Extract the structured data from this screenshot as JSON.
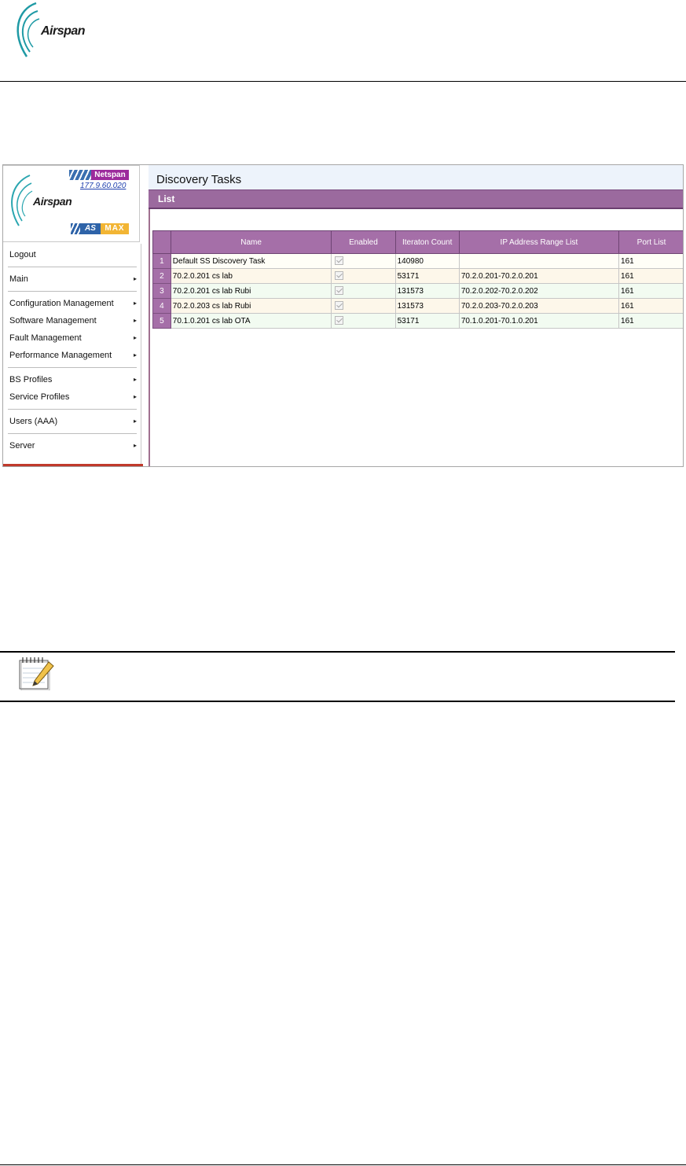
{
  "document": {
    "brand": "Airspan"
  },
  "app": {
    "sidebar": {
      "brand": "Airspan",
      "netspan_label": "Netspan",
      "version": "177.9.60.020",
      "asmax_as": "AS",
      "asmax_max": "MAX",
      "menu": [
        {
          "label": "Logout",
          "arrow": ""
        },
        {
          "label": "Main",
          "arrow": "▸"
        },
        {
          "label": "Configuration Management",
          "arrow": "▸"
        },
        {
          "label": "Software Management",
          "arrow": "▸"
        },
        {
          "label": "Fault Management",
          "arrow": "▸"
        },
        {
          "label": "Performance Management",
          "arrow": "▸"
        },
        {
          "label": "BS Profiles",
          "arrow": "▸"
        },
        {
          "label": "Service Profiles",
          "arrow": "▸"
        },
        {
          "label": "Users (AAA)",
          "arrow": "▸"
        },
        {
          "label": "Server",
          "arrow": "▸"
        }
      ]
    },
    "content": {
      "title": "Discovery Tasks",
      "section": "List",
      "columns": [
        "Name",
        "Enabled",
        "Iteraton Count",
        "IP Address Range List",
        "Port List"
      ],
      "rows": [
        {
          "num": "1",
          "name": "Default SS Discovery Task",
          "enabled": true,
          "count": "140980",
          "range": "",
          "port": "161"
        },
        {
          "num": "2",
          "name": "70.2.0.201 cs lab",
          "enabled": true,
          "count": "53171",
          "range": "70.2.0.201-70.2.0.201",
          "port": "161"
        },
        {
          "num": "3",
          "name": "70.2.0.201 cs lab Rubi",
          "enabled": true,
          "count": "131573",
          "range": "70.2.0.202-70.2.0.202",
          "port": "161"
        },
        {
          "num": "4",
          "name": "70.2.0.203 cs lab Rubi",
          "enabled": true,
          "count": "131573",
          "range": "70.2.0.203-70.2.0.203",
          "port": "161"
        },
        {
          "num": "5",
          "name": "70.1.0.201 cs lab OTA",
          "enabled": true,
          "count": "53171",
          "range": "70.1.0.201-70.1.0.201",
          "port": "161"
        }
      ]
    }
  },
  "icons": {
    "note": "notepad-pencil-icon",
    "logo": "airspan-arcs-icon"
  },
  "colors": {
    "header_purple": "#a56fa8",
    "list_bar": "#9b6a9e",
    "netspan_magenta": "#9c2b9c",
    "asmax_blue": "#2e63a8",
    "asmax_orange": "#f2b534"
  }
}
